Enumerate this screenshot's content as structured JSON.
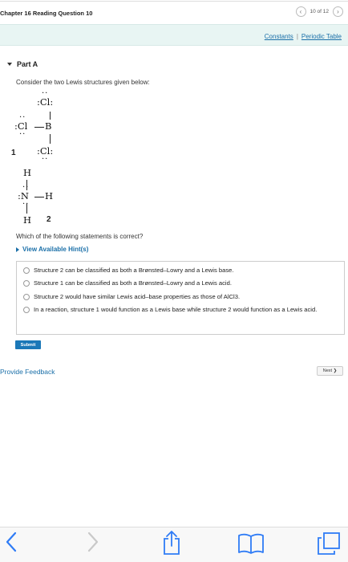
{
  "header": {
    "chapter_title": "Chapter 16 Reading Question 10",
    "page_indicator": "10 of 12"
  },
  "links": {
    "constants": "Constants",
    "separator": "|",
    "periodic_table": "Periodic Table"
  },
  "part": {
    "title": "Part A",
    "prompt": "Consider the two Lewis structures given below:"
  },
  "structures": {
    "s1": {
      "cl_top": ":Cl:",
      "cl_left": ":Cl",
      "b": "B",
      "cl_bottom": ":Cl:",
      "label": "1"
    },
    "s2": {
      "h_top": "H",
      "n": ":N",
      "h_right": "H",
      "h_bottom": "H",
      "label": "2"
    }
  },
  "question": "Which of the following statements is correct?",
  "hint": "View Available Hint(s)",
  "options": [
    "Structure 2 can be classified as both a Brønsted–Lowry and a Lewis base.",
    "Structure 1 can be classified as both a Brønsted–Lowry and a Lewis acid.",
    "Structure 2 would have similar Lewis acid–base properties as those of AlCl3.",
    "In a reaction, structure 1 would function as a Lewis base while structure 2 would function as a Lewis acid."
  ],
  "submit_label": "Submit",
  "feedback_label": "Provide Feedback",
  "next_label": "Next ❯",
  "accent_color": "#1a6fa8"
}
